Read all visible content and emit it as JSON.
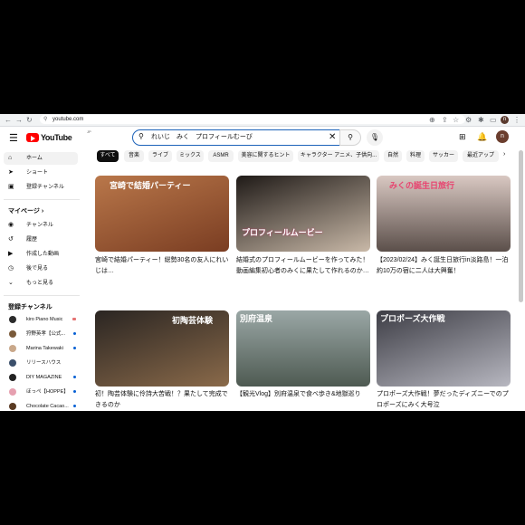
{
  "browser": {
    "url": "youtube.com",
    "profile_initial": "n"
  },
  "header": {
    "logo_text": "YouTube",
    "logo_suffix": "JP",
    "search_value": "れいじ　みく　プロフィールむーび",
    "avatar_initial": "n"
  },
  "sidebar": {
    "main": [
      {
        "label": "ホーム",
        "icon": "home-icon"
      },
      {
        "label": "ショート",
        "icon": "shorts-icon"
      },
      {
        "label": "登録チャンネル",
        "icon": "subscriptions-icon"
      }
    ],
    "you_header": "マイページ",
    "you": [
      {
        "label": "チャンネル",
        "icon": "channel-icon"
      },
      {
        "label": "履歴",
        "icon": "history-icon"
      },
      {
        "label": "作成した動画",
        "icon": "your-videos-icon"
      },
      {
        "label": "後で見る",
        "icon": "watch-later-icon"
      },
      {
        "label": "もっと見る",
        "icon": "chevron-down-icon"
      }
    ],
    "subs_header": "登録チャンネル",
    "subs": [
      {
        "label": "kiro Piano Music",
        "color": "#2b2b2b"
      },
      {
        "label": "狩野英孝【公式...",
        "color": "#7a5a3a"
      },
      {
        "label": "Marina Takewaki",
        "color": "#c9a88a"
      },
      {
        "label": "リリースハウス",
        "color": "#3b4f6b"
      },
      {
        "label": "DIY MAGAZINE",
        "color": "#222222"
      },
      {
        "label": "ほっぺ【HOPPE】",
        "color": "#e6a0b0"
      },
      {
        "label": "Chocolate Cacao...",
        "color": "#5a3a22"
      }
    ]
  },
  "chips": [
    "すべて",
    "音楽",
    "ライブ",
    "ミックス",
    "ASMR",
    "美容に関するヒント",
    "キャラクター アニメ、子供向...",
    "自然",
    "料理",
    "サッカー",
    "最近アップ"
  ],
  "videos": [
    {
      "title": "宮崎で結婚パーティー！総勢30名の友人にれいじは…",
      "thumb_text": "宮崎で結婚パーティー",
      "bg": "#b9774a",
      "bg2": "#7a3d22",
      "text_color": "#ffffff"
    },
    {
      "title": "結婚式のプロフィールムービーを作ってみた！動画編集初心者のみくに果たして作れるのか…",
      "thumb_text": "プロフィールムービー",
      "bg": "#1f1a17",
      "bg2": "#c9b9a8",
      "text_color": "#ffffff"
    },
    {
      "title": "【2023/02/24】みく誕生日旅行in淡路島！一泊約10万の宿に二人は大興奮！",
      "thumb_text": "みくの誕生日旅行",
      "bg": "#d9c8c2",
      "bg2": "#5b4f4a",
      "text_color": "#e8436f"
    },
    {
      "title": "初！陶芸体験に伶詩大苦戦！？果たして完成できるのか",
      "thumb_text": "初陶芸体験",
      "bg": "#2a2522",
      "bg2": "#8a6a4a",
      "text_color": "#ffffff"
    },
    {
      "title": "【観光Vlog】別府温泉で食べ歩き&地獄巡り",
      "thumb_text": "別府温泉",
      "bg": "#9aa7a6",
      "bg2": "#4e5a52",
      "text_color": "#ffffff"
    },
    {
      "title": "プロポーズ大作戦！夢だったディズニーでのプロポーズにみく大号泣",
      "thumb_text": "プロポーズ大作戦",
      "bg": "#3d3d45",
      "bg2": "#b7b7c0",
      "text_color": "#ffffff"
    }
  ]
}
